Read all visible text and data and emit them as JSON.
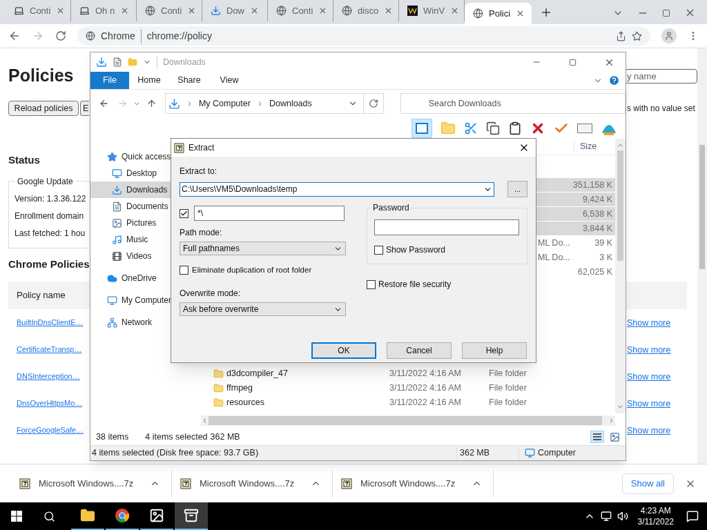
{
  "browser": {
    "tabs": [
      {
        "title": "Conti",
        "kind": "support",
        "selected": false
      },
      {
        "title": "Oh n",
        "kind": "support",
        "selected": false
      },
      {
        "title": "Conti",
        "kind": "globe",
        "selected": false
      },
      {
        "title": "Dow",
        "kind": "download",
        "selected": false
      },
      {
        "title": "Conti",
        "kind": "globe",
        "selected": false
      },
      {
        "title": "disco",
        "kind": "globe",
        "selected": false
      },
      {
        "title": "WinV",
        "kind": "logo",
        "selected": false
      },
      {
        "title": "Polici",
        "kind": "globe",
        "selected": true
      }
    ],
    "omnibox": {
      "chip": "Chrome",
      "url": "chrome://policy"
    }
  },
  "page": {
    "title": "Policies",
    "filter_placeholder": "y name",
    "buttons": [
      "Reload policies",
      "E"
    ],
    "no_value_option": "s with no value set",
    "status": {
      "heading": "Status",
      "legend": "Google Update",
      "lines": [
        "Version: 1.3.36.122",
        "Enrollment domain",
        "Last fetched: 1 hou"
      ]
    },
    "policies": {
      "heading": "Chrome Policies",
      "column": "Policy name",
      "rows": [
        {
          "name": "BuiltInDnsClientE…",
          "action": "Show more"
        },
        {
          "name": "CertificateTransp…",
          "action": "Show more"
        },
        {
          "name": "DNSInterception…",
          "action": "Show more"
        },
        {
          "name": "DnsOverHttpsMo…",
          "action": "Show more"
        },
        {
          "name": "ForceGoogleSafe…",
          "action": "Show more"
        }
      ]
    }
  },
  "explorer": {
    "title": "Downloads",
    "ribbon_tabs": [
      {
        "label": "File",
        "selected": true
      },
      {
        "label": "Home",
        "selected": false
      },
      {
        "label": "Share",
        "selected": false
      },
      {
        "label": "View",
        "selected": false
      }
    ],
    "breadcrumb": [
      "My Computer",
      "Downloads"
    ],
    "search_placeholder": "Search Downloads",
    "nav": [
      {
        "label": "Quick access",
        "kind": "star",
        "selected": false,
        "children": [
          {
            "label": "Desktop",
            "kind": "desktop",
            "selected": false
          },
          {
            "label": "Downloads",
            "kind": "download",
            "selected": true
          },
          {
            "label": "Documents",
            "kind": "document",
            "selected": false
          },
          {
            "label": "Pictures",
            "kind": "picture",
            "selected": false
          },
          {
            "label": "Music",
            "kind": "music",
            "selected": false
          },
          {
            "label": "Videos",
            "kind": "video",
            "selected": false
          }
        ]
      },
      {
        "label": "OneDrive",
        "kind": "cloud",
        "selected": false
      },
      {
        "label": "My Computer",
        "kind": "computer",
        "selected": false
      },
      {
        "label": "Network",
        "kind": "network",
        "selected": false
      }
    ],
    "column": "Size",
    "rows_upper": [
      {
        "size": "351,158 K",
        "selected": true
      },
      {
        "size": "9,424 K",
        "selected": true
      },
      {
        "size": "6,538 K",
        "selected": true
      },
      {
        "size": "3,844 K",
        "selected": true
      },
      {
        "type": "ML Do...",
        "size": "39 K",
        "selected": false
      },
      {
        "type": "ML Do...",
        "size": "3 K",
        "selected": false
      },
      {
        "size": "62,025 K",
        "selected": false
      }
    ],
    "rows_lower": [
      {
        "name": "d3dcompiler_47",
        "date": "3/11/2022 4:16 AM",
        "type": "File folder",
        "selected": false
      },
      {
        "name": "ffmpeg",
        "date": "3/11/2022 4:16 AM",
        "type": "File folder",
        "selected": false
      },
      {
        "name": "resources",
        "date": "3/11/2022 4:16 AM",
        "type": "File folder",
        "selected": false
      }
    ],
    "item_count": "38 items",
    "selection": "4 items selected",
    "selection_size": "362 MB",
    "status": {
      "text": "4 items selected (Disk free space: 93.7 GB)",
      "size": "362 MB",
      "location": "Computer"
    }
  },
  "dialog": {
    "title": "Extract",
    "extract_to_label": "Extract to:",
    "path": "C:\\Users\\VM5\\Downloads\\temp",
    "browse": "...",
    "filter": {
      "checked": true,
      "value": "*\\"
    },
    "path_mode": {
      "label": "Path mode:",
      "value": "Full pathnames"
    },
    "eliminate_root": {
      "label": "Eliminate duplication of root folder",
      "checked": false
    },
    "overwrite_mode": {
      "label": "Overwrite mode:",
      "value": "Ask before overwrite"
    },
    "password": {
      "legend": "Password",
      "show_label": "Show Password",
      "show_checked": false
    },
    "restore_security": {
      "label": "Restore file security",
      "checked": false
    },
    "buttons": [
      {
        "label": "OK",
        "focused": true
      },
      {
        "label": "Cancel",
        "focused": false
      },
      {
        "label": "Help",
        "focused": false
      }
    ]
  },
  "downloads": {
    "items": [
      "Microsoft Windows....7z",
      "Microsoft Windows....7z",
      "Microsoft Windows....7z"
    ],
    "show_all": "Show all"
  },
  "taskbar": {
    "apps": [
      {
        "kind": "explorer",
        "selected": false
      },
      {
        "kind": "chrome",
        "selected": false
      },
      {
        "kind": "photos",
        "selected": false
      },
      {
        "kind": "archiver",
        "selected": true
      }
    ],
    "time": "4:23 AM",
    "date": "3/11/2022"
  }
}
